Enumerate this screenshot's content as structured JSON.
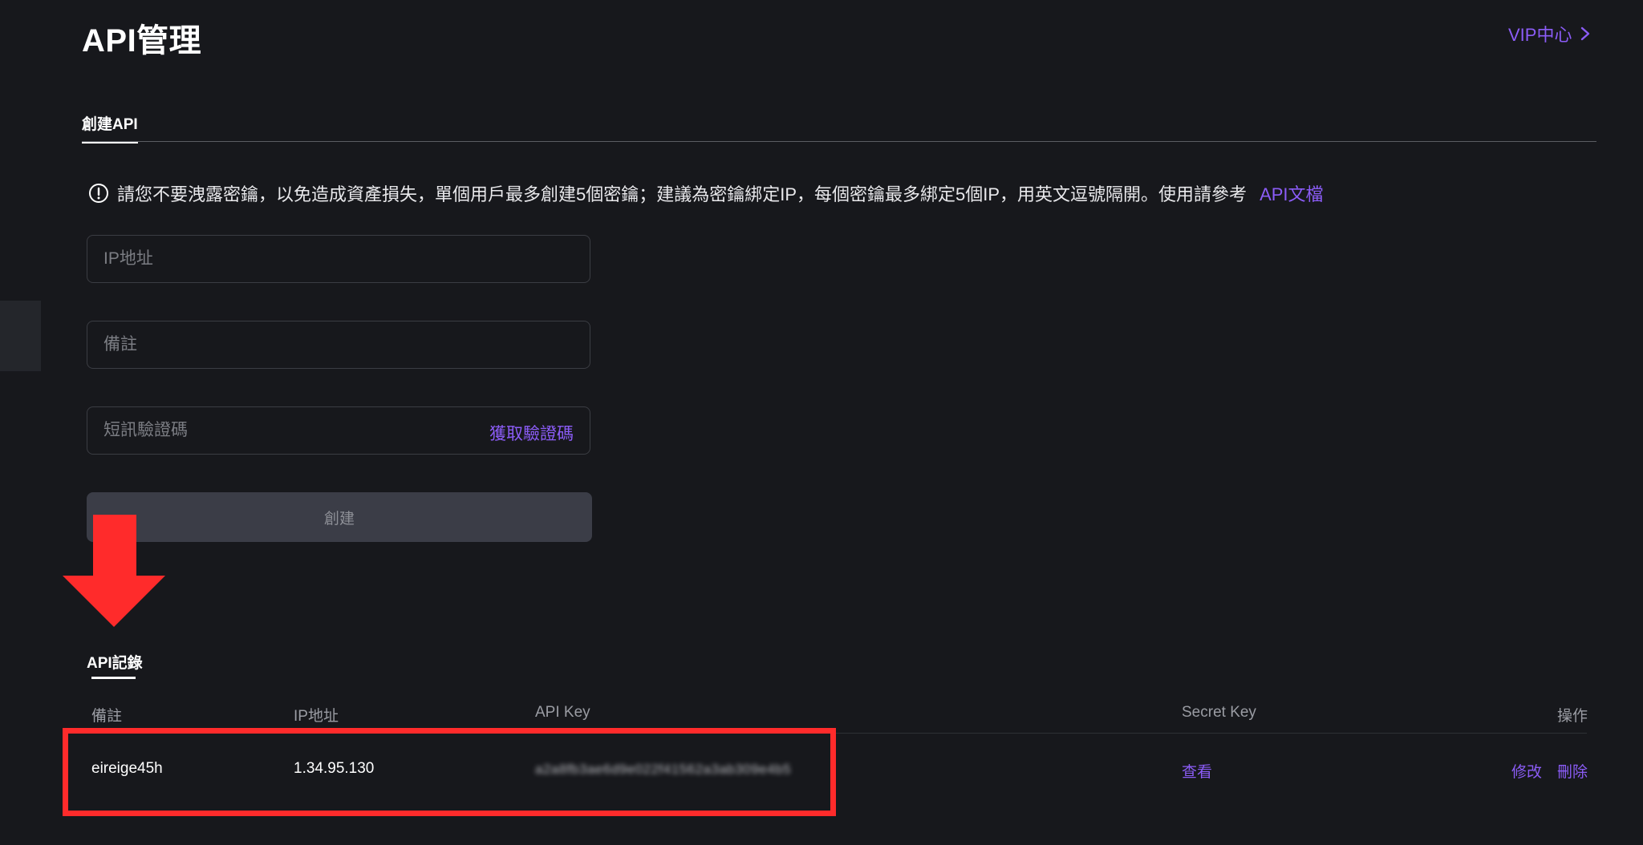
{
  "header": {
    "title": "API管理",
    "vip_label": "VIP中心"
  },
  "tabs": [
    {
      "label": "創建API",
      "active": true
    }
  ],
  "notice": {
    "text": "請您不要洩露密鑰，以免造成資產損失，單個用戶最多創建5個密鑰；建議為密鑰綁定IP，每個密鑰最多綁定5個IP，用英文逗號隔開。使用請參考",
    "link_label": "API文檔"
  },
  "form": {
    "ip_placeholder": "IP地址",
    "note_placeholder": "備註",
    "sms_placeholder": "短訊驗證碼",
    "get_code_label": "獲取驗證碼",
    "create_label": "創建"
  },
  "records": {
    "title": "API記錄",
    "columns": [
      "備註",
      "IP地址",
      "API Key",
      "Secret Key",
      "操作"
    ],
    "rows": [
      {
        "note": "eireige45h",
        "ip": "1.34.95.130",
        "api_key": "a2a8fb3ae6d9e022f41562a3ab309e4b5",
        "secret_key_action": "查看",
        "edit": "修改",
        "delete": "刪除"
      }
    ]
  },
  "colors": {
    "background": "#17181c",
    "accent": "#8b5cf6",
    "highlight": "#ff2b2b",
    "button_bg": "#3b3d47"
  },
  "icons": [
    "info-circle-icon",
    "chevron-right-icon",
    "down-arrow-annotation"
  ]
}
